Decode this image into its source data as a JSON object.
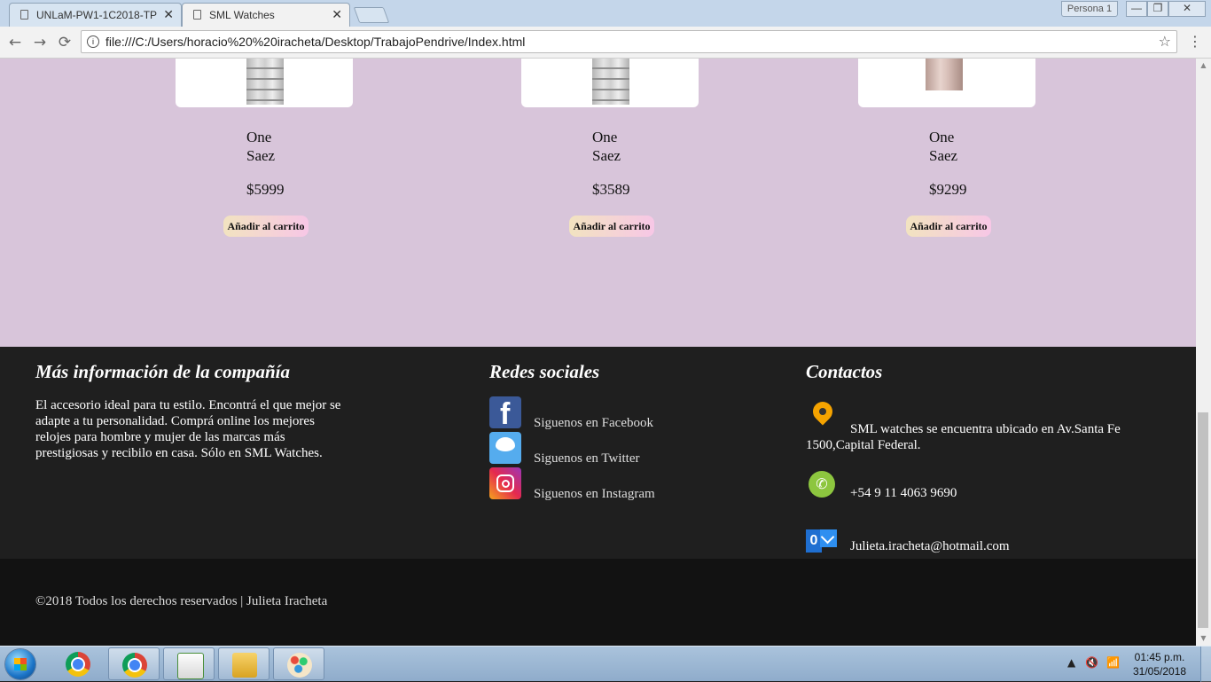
{
  "browser": {
    "tabs": [
      {
        "title": "UNLaM-PW1-1C2018-TP",
        "close": "✕"
      },
      {
        "title": "SML Watches",
        "close": "✕"
      }
    ],
    "profile": "Persona 1",
    "window_controls": {
      "minimize": "—",
      "maximize": "❐",
      "close": "✕"
    },
    "nav": {
      "back": "←",
      "forward": "→",
      "reload": "⟳"
    },
    "info_icon": "i",
    "url": "file:///C:/Users/horacio%20%20iracheta/Desktop/TrabajoPendrive/Index.html",
    "star": "☆",
    "menu": "⋮"
  },
  "products": [
    {
      "name_line1": "One",
      "name_line2": "Saez",
      "price": "$5999",
      "button": "Añadir al carrito",
      "strap": "steel"
    },
    {
      "name_line1": "One",
      "name_line2": "Saez",
      "price": "$3589",
      "button": "Añadir al carrito",
      "strap": "steel"
    },
    {
      "name_line1": "One",
      "name_line2": "Saez",
      "price": "$9299",
      "button": "Añadir al carrito",
      "strap": "rose-mesh"
    }
  ],
  "footer": {
    "company": {
      "heading": "Más información de la compañía",
      "text": "El accesorio ideal para tu estilo. Encontrá el que mejor se adapte a tu personalidad. Comprá online los mejores relojes para hombre y mujer de las marcas más prestigiosas y recibilo en casa. Sólo en SML Watches."
    },
    "social": {
      "heading": "Redes sociales",
      "items": [
        {
          "label": "Siguenos en Facebook",
          "icon": "facebook-icon",
          "glyph": "f",
          "color": "#3b5998"
        },
        {
          "label": "Siguenos en Twitter",
          "icon": "twitter-icon",
          "color": "#55acee"
        },
        {
          "label": "Siguenos en Instagram",
          "icon": "instagram-icon",
          "color": "#e5294e"
        }
      ]
    },
    "contact": {
      "heading": "Contactos",
      "address": "SML watches se encuentra ubicado en Av.Santa Fe 1500,Capital Federal.",
      "phone": "+54 9 11 4063 9690",
      "email": "Julieta.iracheta@hotmail.com",
      "phone_glyph": "✆",
      "mail_glyph": "0"
    },
    "copyright": "©2018 Todos los derechos reservados | Julieta Iracheta"
  },
  "scrollbar": {
    "up": "▲",
    "down": "▼"
  },
  "taskbar": {
    "apps": [
      {
        "name": "chrome-pinned",
        "icon": "chrome-icon"
      },
      {
        "name": "chrome-running",
        "icon": "chrome-icon"
      },
      {
        "name": "notepad-plus",
        "icon": "notepad-icon"
      },
      {
        "name": "file-explorer",
        "icon": "folder-icon"
      },
      {
        "name": "paint",
        "icon": "paint-icon"
      }
    ],
    "tray": {
      "show_hidden": "▲",
      "volume": "🔇",
      "network": "📶",
      "time": "01:45 p.m.",
      "date": "31/05/2018"
    }
  },
  "colors": {
    "products_bg": "#d8c5da",
    "footer_bg": "#1f1f1f",
    "copyright_bg": "#121212",
    "cart_button_gradient": [
      "#f2e3c0",
      "#f7c7e6"
    ]
  }
}
